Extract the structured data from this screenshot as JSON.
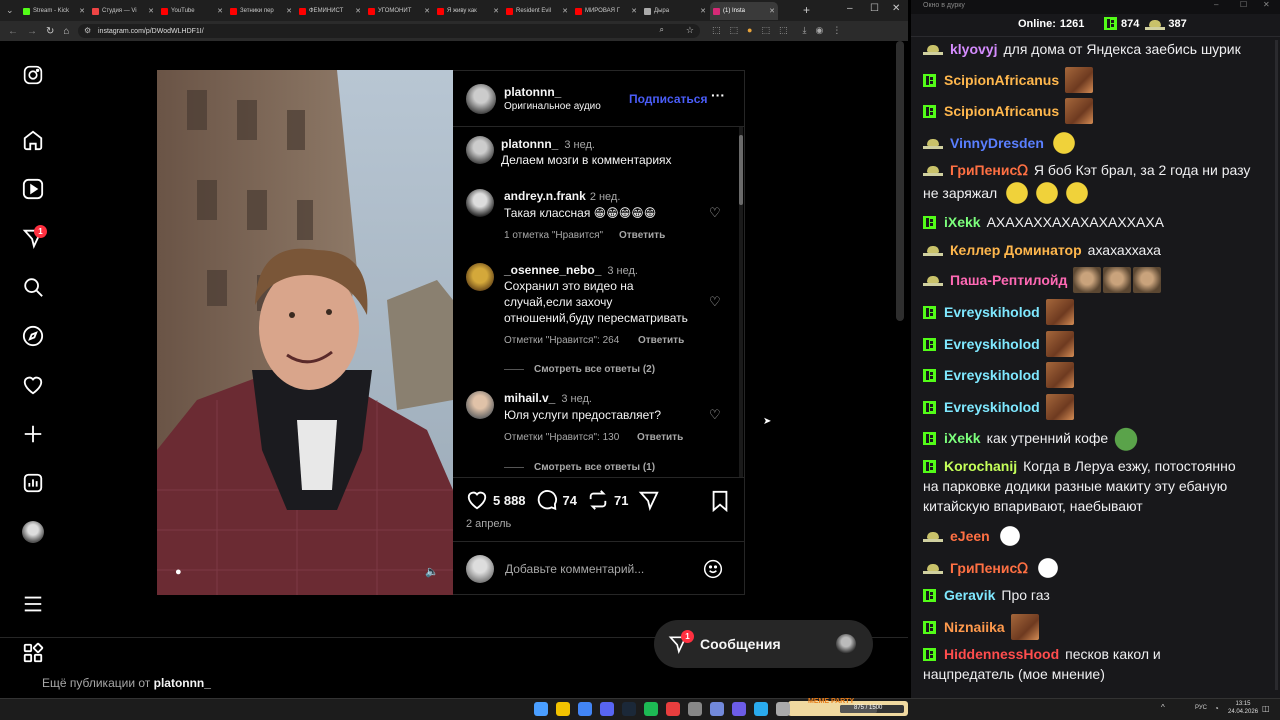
{
  "browser": {
    "tabs": [
      {
        "label": "Stream - Kick",
        "color": "#53fc18"
      },
      {
        "label": "Студия — Vi",
        "color": "#e44"
      },
      {
        "label": "YouTube",
        "color": "#f00"
      },
      {
        "label": "Зетники пер",
        "color": "#f00"
      },
      {
        "label": "ФЕМИНИСТ",
        "color": "#f00"
      },
      {
        "label": "УГОМОНИТ",
        "color": "#f00"
      },
      {
        "label": "Я живу как",
        "color": "#f00"
      },
      {
        "label": "Resident Evil",
        "color": "#f00"
      },
      {
        "label": "МИРОВАЯ Г",
        "color": "#f00"
      },
      {
        "label": "Дыра",
        "color": "#aaa"
      },
      {
        "label": "(1) Insta",
        "color": "#d62976"
      }
    ],
    "url": "instagram.com/p/DWodWLHDF1I/"
  },
  "instagram": {
    "nav_badge": "1",
    "post": {
      "username": "platonnn_",
      "audio": "Оригинальное аудио",
      "follow_label": "Подписаться",
      "caption": {
        "user": "platonnn_",
        "time": "3 нед.",
        "text": "Делаем мозги в комментариях"
      },
      "comments": [
        {
          "user": "andrey.n.frank",
          "time": "2 нед.",
          "text": "Такая классная 😁😁😁😁😁",
          "likes": "1 отметка \"Нравится\"",
          "reply": "Ответить"
        },
        {
          "user": "_osennee_nebo_",
          "time": "3 нед.",
          "text": "Сохранил это видео на случай,если захочу отношений,буду пересматривать",
          "likes": "Отметки \"Нравится\": 264",
          "reply": "Ответить",
          "view_replies": "Смотреть все ответы (2)"
        },
        {
          "user": "mihail.v_",
          "time": "3 нед.",
          "text": "Юля услуги предоставляет?",
          "likes": "Отметки \"Нравится\": 130",
          "reply": "Ответить",
          "view_replies": "Смотреть все ответы (1)"
        }
      ],
      "like_count": "5 888",
      "comment_count": "74",
      "repost_count": "71",
      "date": "2 апрель",
      "comment_placeholder": "Добавьте комментарий..."
    },
    "more_from_prefix": "Ещё публикации от",
    "more_from_user": "platonnn_",
    "messages_label": "Сообщения",
    "messages_badge": "1"
  },
  "chat": {
    "window_title": "Окно в дурку",
    "online_label": "Online:",
    "online_count": "1261",
    "kick_count": "874",
    "twitch_count": "387",
    "messages": [
      {
        "platform": "twitch",
        "name": "klyovyj",
        "color": "#d58cff",
        "text": "для дома от Яндекса заебись шурик",
        "emotes": []
      },
      {
        "platform": "kick",
        "name": "ScipionAfricanus",
        "color": "#ffb74d",
        "text": "",
        "emotes": [
          "em-brown"
        ]
      },
      {
        "platform": "kick",
        "name": "ScipionAfricanus",
        "color": "#ffb74d",
        "text": "",
        "emotes": [
          "em-brown"
        ]
      },
      {
        "platform": "twitch",
        "name": "VinnyDresden",
        "color": "#5a7fff",
        "text": "",
        "emotes": [
          "em-yellow"
        ]
      },
      {
        "platform": "twitch",
        "name": "ГриПенисᘯ",
        "color": "#ff7043",
        "text": "Я боб Кэт брал, за 2 года ни разу",
        "text2": "не заряжал",
        "emotes": [
          "em-yellow",
          "em-yellow",
          "em-yellow"
        ]
      },
      {
        "platform": "kick",
        "name": "iXekk",
        "color": "#7cff7c",
        "text": "АХАХАХХАХАХАХАХХАХА",
        "emotes": []
      },
      {
        "platform": "twitch",
        "name": "Келлер Доминатор",
        "color": "#ffb74d",
        "text": "ахахаххаха",
        "emotes": []
      },
      {
        "platform": "twitch",
        "name": "Паша-Рептилойд",
        "color": "#ff69b4",
        "text": "",
        "emotes": [
          "em-face",
          "em-face",
          "em-face"
        ]
      },
      {
        "platform": "kick",
        "name": "Evreyskiholod",
        "color": "#7fe8ff",
        "text": "",
        "emotes": [
          "em-brown"
        ]
      },
      {
        "platform": "kick",
        "name": "Evreyskiholod",
        "color": "#7fe8ff",
        "text": "",
        "emotes": [
          "em-brown"
        ]
      },
      {
        "platform": "kick",
        "name": "Evreyskiholod",
        "color": "#7fe8ff",
        "text": "",
        "emotes": [
          "em-brown"
        ]
      },
      {
        "platform": "kick",
        "name": "Evreyskiholod",
        "color": "#7fe8ff",
        "text": "",
        "emotes": [
          "em-brown"
        ]
      },
      {
        "platform": "kick",
        "name": "iXekk",
        "color": "#7cff7c",
        "text": "как утренний кофе",
        "emotes": [
          "em-green"
        ]
      },
      {
        "platform": "kick",
        "name": "Korochanij",
        "color": "#c5ff5a",
        "text": "Когда в Леруа езжу, потостоянно",
        "text2": "на парковке додики разные макиту эту ебаную",
        "text3": "китайскую впаривают, наебывают",
        "emotes": []
      },
      {
        "platform": "twitch",
        "name": "eJeen",
        "color": "#ff7043",
        "text": "",
        "emotes": [
          "em-clown"
        ]
      },
      {
        "platform": "twitch",
        "name": "ГриПенисᘯ",
        "color": "#ff7043",
        "text": "",
        "emotes": [
          "em-clown"
        ]
      },
      {
        "platform": "kick",
        "name": "Geravik",
        "color": "#7fe8ff",
        "text": "Про газ",
        "emotes": []
      },
      {
        "platform": "kick",
        "name": "Niznaiika",
        "color": "#ff9a4d",
        "text": "",
        "emotes": [
          "em-brown"
        ]
      },
      {
        "platform": "kick",
        "name": "HiddennessHood",
        "color": "#ff4d4d",
        "text": "песков какол и",
        "text2": "нацпредатель (мое мнение)",
        "emotes": []
      }
    ]
  },
  "taskbar": {
    "meme_label": "MEME PARTY",
    "meme_counter": "875 / 1500",
    "lang": "РУС",
    "time": "13:15",
    "date": "24.04.2026"
  }
}
